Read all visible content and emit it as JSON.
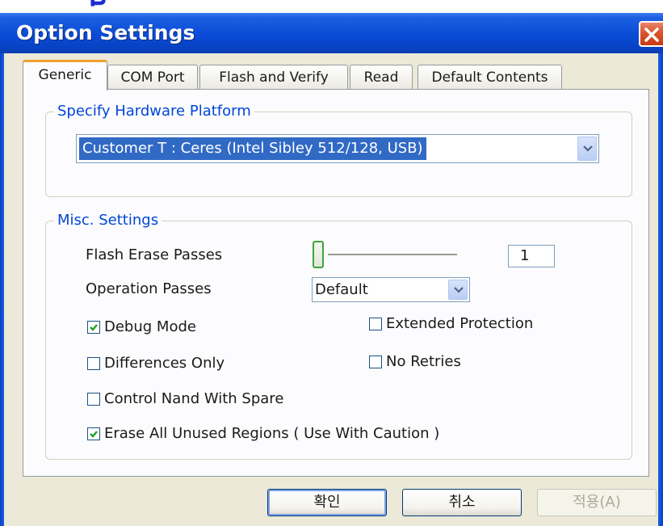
{
  "window": {
    "title": "Option Settings",
    "close_icon": "close-icon"
  },
  "tabs": [
    {
      "label": "Generic",
      "active": true
    },
    {
      "label": "COM Port",
      "active": false
    },
    {
      "label": "Flash and Verify",
      "active": false
    },
    {
      "label": "Read",
      "active": false
    },
    {
      "label": "Default Contents",
      "active": false
    }
  ],
  "hardware_group": {
    "legend": "Specify Hardware Platform",
    "selected_platform": "Customer T : Ceres (Intel Sibley 512/128, USB)"
  },
  "misc_group": {
    "legend": "Misc. Settings",
    "flash_erase_passes": {
      "label": "Flash Erase Passes",
      "value": "1",
      "slider_level": 0
    },
    "operation_passes": {
      "label": "Operation Passes",
      "value": "Default"
    },
    "checkboxes": [
      {
        "label": "Debug Mode",
        "checked": true
      },
      {
        "label": "Extended Protection",
        "checked": false
      },
      {
        "label": "Differences Only",
        "checked": false
      },
      {
        "label": "No Retries",
        "checked": false
      },
      {
        "label": "Control Nand With Spare",
        "checked": false
      },
      {
        "label": "Erase All Unused Regions ( Use With Caution )",
        "checked": true
      }
    ]
  },
  "buttons": {
    "ok": "확인",
    "cancel": "취소",
    "apply": "적용(A)",
    "apply_enabled": false
  },
  "colors": {
    "title_bar": "#0a4bd6",
    "group_legend": "#0046d5",
    "selection": "#316ac5",
    "active_tab_accent": "#f2a12b",
    "close_button": "#d9542b",
    "checkmark": "#21a121"
  }
}
